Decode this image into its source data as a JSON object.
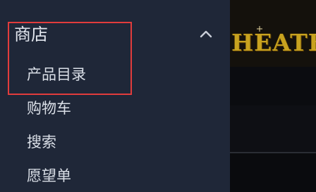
{
  "menu": {
    "section_title": "商店",
    "items": [
      {
        "label": "产品目录"
      },
      {
        "label": "购物车"
      },
      {
        "label": "搜索"
      },
      {
        "label": "愿望单"
      }
    ]
  },
  "preview": {
    "logo_text": "HEATE"
  },
  "colors": {
    "sidebar_bg": "#1f2738",
    "highlight_border": "#e23c3c",
    "logo_gold": "#c8a21f"
  },
  "icons": {
    "collapse": "chevron-up-icon"
  }
}
